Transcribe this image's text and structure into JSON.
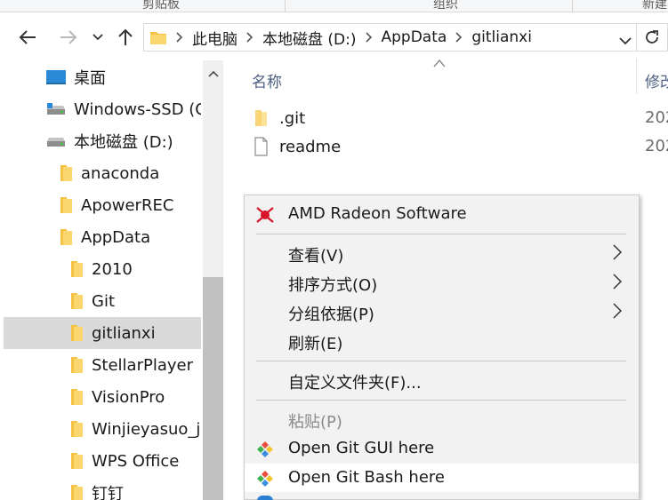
{
  "ribbon": {
    "groups": [
      "剪贴板",
      "组织",
      "新建"
    ]
  },
  "address_bar": {
    "breadcrumbs": [
      "此电脑",
      "本地磁盘 (D:)",
      "AppData",
      "gitlianxi"
    ],
    "back_icon": "arrow-left-icon",
    "forward_icon": "arrow-right-icon",
    "recent_icon": "chevron-down-icon",
    "up_icon": "arrow-up-icon",
    "refresh_icon": "refresh-icon"
  },
  "nav_pane": {
    "items": [
      {
        "label": "桌面",
        "icon": "desktop-icon",
        "selected": false
      },
      {
        "label": "Windows-SSD (C:)",
        "icon": "drive-icon",
        "selected": false
      },
      {
        "label": "本地磁盘 (D:)",
        "icon": "drive-icon",
        "selected": false
      },
      {
        "label": "anaconda",
        "icon": "folder-icon",
        "selected": false
      },
      {
        "label": "ApowerREC",
        "icon": "folder-icon",
        "selected": false
      },
      {
        "label": "AppData",
        "icon": "folder-icon",
        "selected": false
      },
      {
        "label": "2010",
        "icon": "folder-icon",
        "selected": false
      },
      {
        "label": "Git",
        "icon": "folder-icon",
        "selected": false
      },
      {
        "label": "gitlianxi",
        "icon": "folder-icon",
        "selected": true
      },
      {
        "label": "StellarPlayer",
        "icon": "folder-icon",
        "selected": false
      },
      {
        "label": "VisionPro",
        "icon": "folder-icon",
        "selected": false
      },
      {
        "label": "Winjieyasuo_ji",
        "icon": "folder-icon",
        "selected": false
      },
      {
        "label": "WPS Office",
        "icon": "folder-icon",
        "selected": false
      },
      {
        "label": "钉钉",
        "icon": "folder-icon",
        "selected": false
      }
    ]
  },
  "content": {
    "columns": [
      "名称",
      "修改"
    ],
    "files": [
      {
        "name": ".git",
        "icon": "folder-icon",
        "date": "202"
      },
      {
        "name": "readme",
        "icon": "file-icon",
        "date": "202"
      }
    ]
  },
  "context_menu": {
    "items": [
      {
        "label": "AMD Radeon Software",
        "icon": "amd-radeon-icon",
        "submenu": false,
        "disabled": false
      },
      {
        "label": "查看(V)",
        "submenu": true,
        "disabled": false
      },
      {
        "label": "排序方式(O)",
        "submenu": true,
        "disabled": false
      },
      {
        "label": "分组依据(P)",
        "submenu": true,
        "disabled": false
      },
      {
        "label": "刷新(E)",
        "submenu": false,
        "disabled": false
      },
      {
        "label": "自定义文件夹(F)...",
        "submenu": false,
        "disabled": false
      },
      {
        "label": "粘贴(P)",
        "submenu": false,
        "disabled": true
      },
      {
        "label": "Open Git GUI here",
        "icon": "git-icon",
        "submenu": false,
        "disabled": false
      },
      {
        "label": "Open Git Bash here",
        "icon": "git-icon",
        "submenu": false,
        "disabled": false,
        "highlighted": true
      }
    ]
  },
  "colors": {
    "folder": "#f5c242",
    "selection": "#d9d9d9",
    "menu_bg": "#f2f2f2",
    "header_text": "#4d6082",
    "amd_red": "#d7152a"
  }
}
